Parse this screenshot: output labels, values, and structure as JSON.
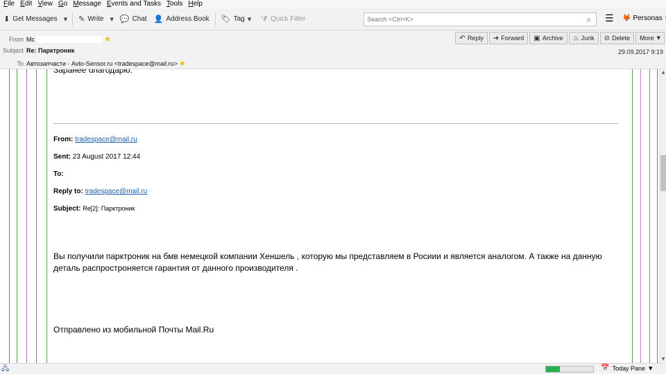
{
  "menu": [
    "File",
    "Edit",
    "View",
    "Go",
    "Message",
    "Events and Tasks",
    "Tools",
    "Help"
  ],
  "toolbar": {
    "get_messages": "Get Messages",
    "write": "Write",
    "chat": "Chat",
    "address_book": "Address Book",
    "tag": "Tag",
    "quick_filter": "Quick Filter",
    "search_placeholder": "Search <Ctrl+K>",
    "personas": "Personas"
  },
  "header": {
    "from_label": "From",
    "from_value": "Mc",
    "subject_label": "Subject",
    "subject_value": "Re: Парктроник",
    "to_label": "To",
    "to_value": "Автозапчасти - Avto-Sensor.ru <tradespace@mail.ru>",
    "date": "29.09.2017 9:19",
    "actions": {
      "reply": "Reply",
      "forward": "Forward",
      "archive": "Archive",
      "junk": "Junk",
      "delete": "Delete",
      "more": "More"
    }
  },
  "message": {
    "partial_line": "Заранее благодарю.",
    "quoted": {
      "from_label": "From:",
      "from_value": "tradespace@mail.ru",
      "sent_label": "Sent:",
      "sent_value": "23 August 2017 12:44",
      "to_label": "To:",
      "reply_to_label": "Reply to:",
      "reply_to_value": "tradespace@mail.ru",
      "subject_label": "Subject:",
      "subject_value": "Re[2]: Парктроник"
    },
    "paragraph": "Вы получили парктроник на бмв немецкой компании Хеншель , которую мы представляем в Росиии и  является аналогом. А также на данную деталь распростроняется гарантия от данного производителя .",
    "signature": "Отправлено из мобильной Почты Mail.Ru"
  },
  "status": {
    "progress": 0.3,
    "today_pane": "Today Pane"
  },
  "colors": {
    "quote_bars": [
      "#6f6fcf",
      "#3aa33a",
      "#b06fb0",
      "#7f7f7f",
      "#5aa05a",
      "#3aa33a",
      "#c080c0",
      "#8080d0",
      "#6f6fcf"
    ],
    "link": "#1f5fae",
    "progress": "#22b14c"
  }
}
